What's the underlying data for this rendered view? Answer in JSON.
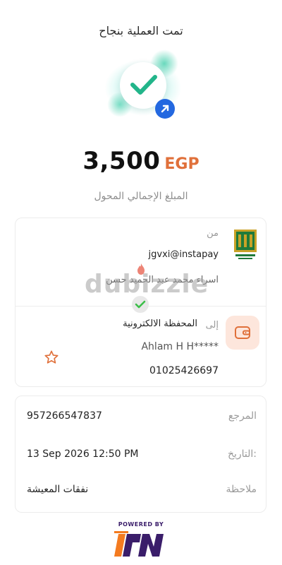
{
  "header": {
    "title": "تمت العملية بنجاح"
  },
  "amount": {
    "value": "3,500",
    "currency": "EGP",
    "label": "المبلغ الإجمالي المحول"
  },
  "from": {
    "label": "من",
    "handle": "jgvxi@instapay",
    "name": "اسراء محمد عبد الحميد حسن"
  },
  "to": {
    "prefix": "إلى",
    "wallet": "المحفظة الالكترونية",
    "name": "Ahlam H H*****",
    "phone": "01025426697"
  },
  "details": {
    "reference_label": "المرجع",
    "reference_value": "957266547837",
    "date_label": "التاريخ:",
    "date_value": "13 Sep 2026 12:50 PM",
    "note_label": "ملاحظة",
    "note_value": "نفقات المعيشة"
  },
  "watermark": {
    "text": "dubizzle"
  },
  "footer": {
    "powered_by": "POWERED BY"
  },
  "colors": {
    "accent_orange": "#e0703a",
    "check_green": "#22b58a",
    "badge_blue": "#2368e0",
    "wallet_tile": "#fde6dc",
    "bank_green": "#1f7a3a",
    "bank_gold": "#c9a227"
  },
  "icons": {
    "success": "check-icon",
    "transfer": "arrow-up-right-icon",
    "wallet": "wallet-icon",
    "favorite": "star-icon",
    "bank": "banque-misr-logo"
  }
}
